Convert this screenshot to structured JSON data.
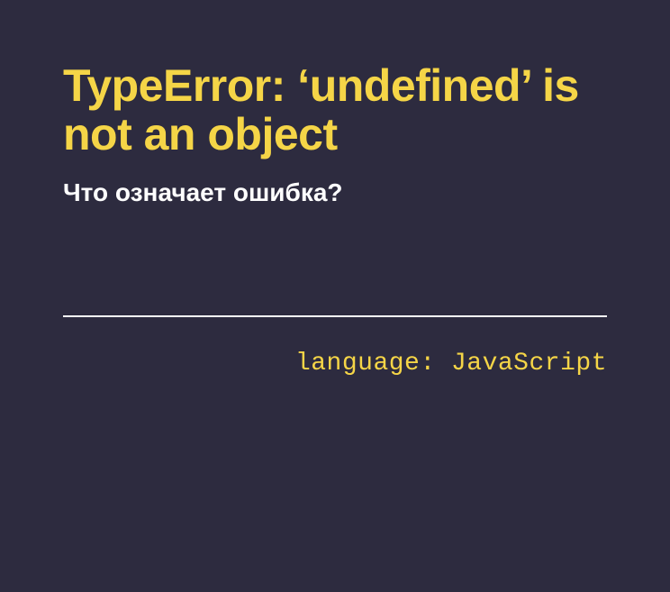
{
  "title": "TypeError: ‘undefined’ is not an object",
  "subtitle": "Что означает ошибка?",
  "language_line": "language: JavaScript"
}
